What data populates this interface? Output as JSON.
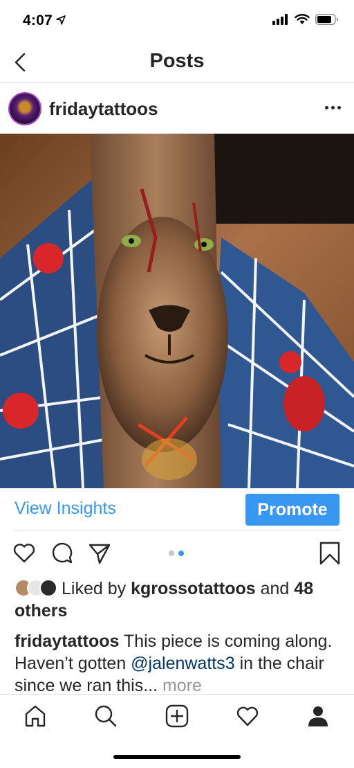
{
  "status_bar": {
    "time": "4:07",
    "icons": [
      "location-arrow-icon",
      "cellular-signal-icon",
      "wifi-icon",
      "battery-icon"
    ]
  },
  "nav": {
    "title": "Posts",
    "back_icon": "chevron-left-icon"
  },
  "post": {
    "username": "fridaytattoos",
    "avatar_icon": "profile-avatar",
    "menu_icon": "more-horizontal-icon",
    "image_description_icon": "post-photo",
    "carousel": {
      "count": 2,
      "active_index": 1
    }
  },
  "insights": {
    "view_insights_label": "View Insights",
    "promote_label": "Promote"
  },
  "actions": {
    "icons": [
      "heart-icon",
      "comment-icon",
      "share-icon",
      "bookmark-icon"
    ]
  },
  "likes": {
    "prefix": "Liked by",
    "user": "kgrossotattoos",
    "conjunction": "and",
    "others": "48 others"
  },
  "caption": {
    "username": "fridaytattoos",
    "text_before_mention": "This piece is coming along. Haven’t gotten",
    "mention": "@jalenwatts3",
    "text_after_mention": "in the chair since we ran this...",
    "more_label": "more"
  },
  "tab_bar": {
    "icons": [
      "home-icon",
      "search-icon",
      "new-post-icon",
      "activity-heart-icon",
      "profile-icon"
    ]
  },
  "colors": {
    "accent": "#3897f0",
    "text": "#262626",
    "mention": "#003569",
    "muted": "#999999",
    "divider": "#dbdbdb"
  }
}
